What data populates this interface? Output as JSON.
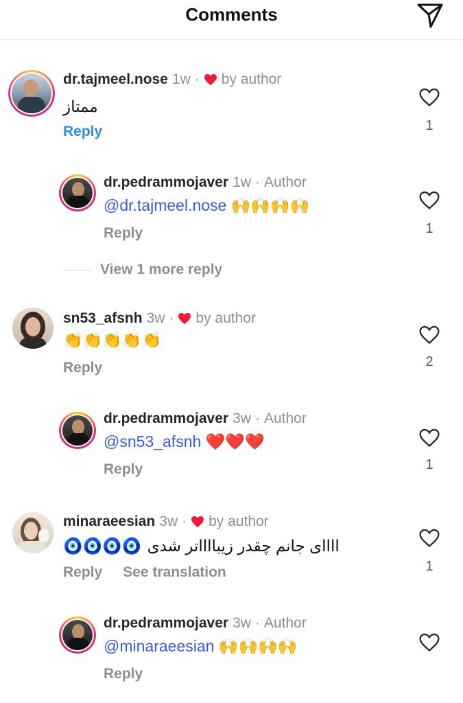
{
  "header": {
    "title": "Comments"
  },
  "comments": [
    {
      "username": "dr.tajmeel.nose",
      "time": "1w",
      "dot": "·",
      "liked_by": "by author",
      "text": "ممتاز",
      "reply": "Reply",
      "likes": "1"
    },
    {
      "username": "dr.pedrammojaver",
      "time": "1w",
      "dot": "·",
      "author_tag": "Author",
      "mention": "@dr.tajmeel.nose",
      "emojis": "🙌🙌🙌🙌",
      "reply": "Reply",
      "likes": "1"
    },
    {
      "username": "sn53_afsnh",
      "time": "3w",
      "dot": "·",
      "liked_by": "by author",
      "emojis": "👏👏👏👏👏",
      "reply": "Reply",
      "likes": "2"
    },
    {
      "username": "dr.pedrammojaver",
      "time": "3w",
      "dot": "·",
      "author_tag": "Author",
      "mention": "@sn53_afsnh",
      "emojis": "❤️❤️❤️",
      "reply": "Reply",
      "likes": "1"
    },
    {
      "username": "minaraeesian",
      "time": "3w",
      "dot": "·",
      "liked_by": "by author",
      "text": "اااای جانم چقدر زیبااااتر شدی",
      "emojis": "🧿🧿🧿🧿",
      "reply": "Reply",
      "see_translation": "See translation",
      "likes": "1"
    },
    {
      "username": "dr.pedrammojaver",
      "time": "3w",
      "dot": "·",
      "author_tag": "Author",
      "mention": "@minaraeesian",
      "emojis": "🙌🙌🙌🙌",
      "reply": "Reply"
    }
  ],
  "view_more": "View 1 more reply",
  "colors": {
    "mention": "#3b5bdb",
    "reply_link": "#2f8fe0",
    "heart": "#ed1c3a",
    "meta_gray": "#8e8e8e"
  },
  "icons": {
    "send": "send-icon",
    "like": "heart-outline-icon",
    "liked_by_author": "red-heart-icon"
  }
}
